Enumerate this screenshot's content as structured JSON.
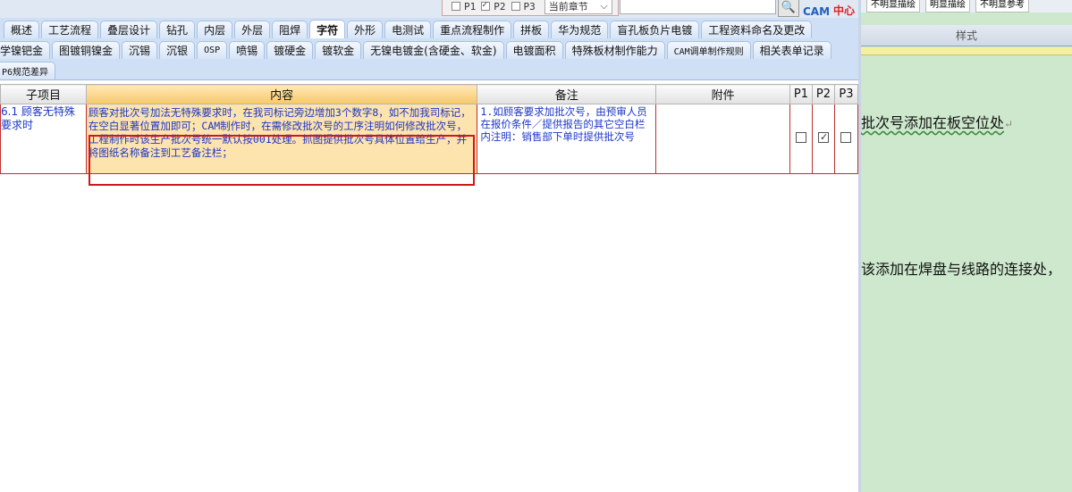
{
  "toolbar": {
    "filters": [
      {
        "label": "P1",
        "checked": false
      },
      {
        "label": "P2",
        "checked": true
      },
      {
        "label": "P3",
        "checked": false
      }
    ],
    "scope_select": "当前章节",
    "search_value": "",
    "logo_text": "CAM",
    "logo_text_red": "中心"
  },
  "tabs": {
    "row1": [
      "概述",
      "工艺流程",
      "叠层设计",
      "钻孔",
      "内层",
      "外层",
      "阻焊",
      "字符",
      "外形",
      "电测试",
      "重点流程制作",
      "拼板",
      "华为规范",
      "盲孔板负片电镀",
      "工程资料命名及更改"
    ],
    "row2": [
      "学镍钯金",
      "图镀铜镍金",
      "沉锡",
      "沉银",
      "OSP",
      "喷锡",
      "镀硬金",
      "镀软金",
      "无镍电镀金(含硬金、软金)",
      "电镀面积",
      "特殊板材制作能力",
      "CAM调单制作规则",
      "相关表单记录"
    ],
    "row3": [
      "P6规范差异"
    ],
    "active": "字符"
  },
  "grid": {
    "headers": {
      "subitem": "子项目",
      "content": "内容",
      "remark": "备注",
      "attachment": "附件",
      "p1": "P1",
      "p2": "P2",
      "p3": "P3"
    },
    "rows": [
      {
        "subitem": "6.1 顾客无特殊要求时",
        "content": "顾客对批次号加法无特殊要求时，在我司标记旁边增加3个数字8，如不加我司标记，在空白显著位置加即可；CAM制作时，在需修改批次号的工序注明如何修改批次号，工程制作时该生产批次号统一默认按001处理。抓图提供批次号具体位置给生产，并将图纸名称备注到工艺备注栏；",
        "remark": "1.如顾客要求加批次号，由预审人员在报价条件／提供报告的其它空白栏内注明：销售部下单时提供批次号",
        "attachment": "",
        "p1": false,
        "p2": true,
        "p3": false
      }
    ]
  },
  "right_panel": {
    "top_buttons": [
      "不明显描绘",
      "明显描绘",
      "不明显参考"
    ],
    "style_label": "样式",
    "doc_line1": "批次号添加在板空位处",
    "doc_line1_mark": "↵",
    "doc_line2": "该添加在焊盘与线路的连接处，"
  }
}
